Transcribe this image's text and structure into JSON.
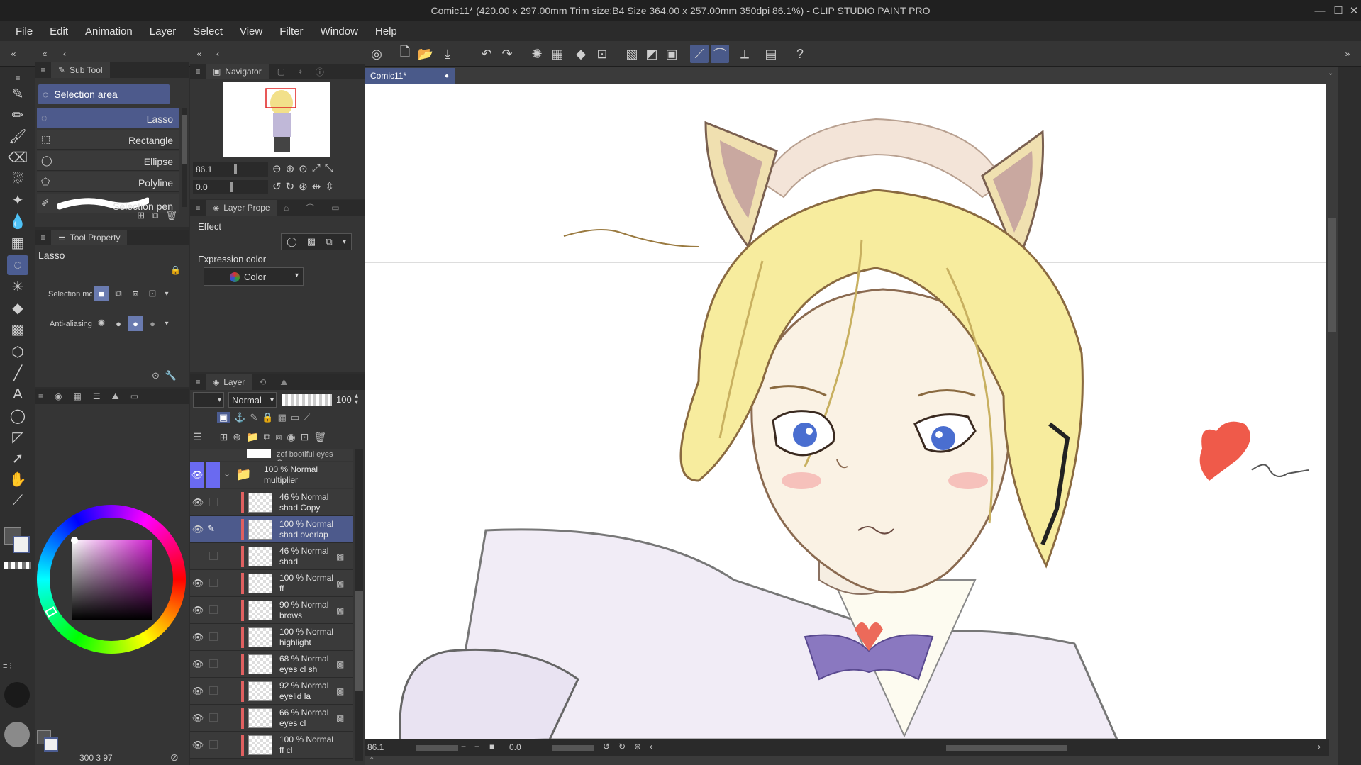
{
  "titlebar": {
    "title": "Comic11* (420.00 x 297.00mm Trim size:B4 Size 364.00 x 257.00mm 350dpi 86.1%)  - CLIP STUDIO PAINT PRO"
  },
  "menu": [
    "File",
    "Edit",
    "Animation",
    "Layer",
    "Select",
    "View",
    "Filter",
    "Window",
    "Help"
  ],
  "subtool_panel": {
    "tab": "Sub Tool",
    "group": "Selection area",
    "items": [
      "Lasso",
      "Rectangle",
      "Ellipse",
      "Polyline",
      "Selection pen"
    ]
  },
  "tool_property": {
    "tab": "Tool Property",
    "tool_name": "Lasso",
    "selection_mode_label": "Selection mo",
    "antialiasing_label": "Anti-aliasing"
  },
  "navigator": {
    "tab": "Navigator",
    "zoom": "86.1",
    "rotation": "0.0"
  },
  "layer_property": {
    "tab": "Layer Prope",
    "effect_label": "Effect",
    "expression_label": "Expression color",
    "expression_value": "Color"
  },
  "layer_panel": {
    "tab": "Layer",
    "blend_mode": "Normal",
    "opacity": "100",
    "top_partial": "zof bootiful eyes Copy",
    "folder": {
      "line1": "100 % Normal",
      "line2": "multiplier"
    },
    "layers": [
      {
        "l1": "46 % Normal",
        "l2": "shad Copy"
      },
      {
        "l1": "100 % Normal",
        "l2": "shad overlap"
      },
      {
        "l1": "46 % Normal",
        "l2": "shad"
      },
      {
        "l1": "100 % Normal",
        "l2": "ff"
      },
      {
        "l1": "90 % Normal",
        "l2": "brows"
      },
      {
        "l1": "100 % Normal",
        "l2": "highlight"
      },
      {
        "l1": "68 % Normal",
        "l2": "eyes cl sh"
      },
      {
        "l1": "92 % Normal",
        "l2": "eyelid la"
      },
      {
        "l1": "66 % Normal",
        "l2": "eyes cl"
      },
      {
        "l1": "100 % Normal",
        "l2": "ff cl"
      }
    ]
  },
  "color_footer": {
    "text": "300  3  97"
  },
  "document": {
    "tab": "Comic11*"
  },
  "statusbar": {
    "zoom": "86.1",
    "rotation": "0.0"
  }
}
